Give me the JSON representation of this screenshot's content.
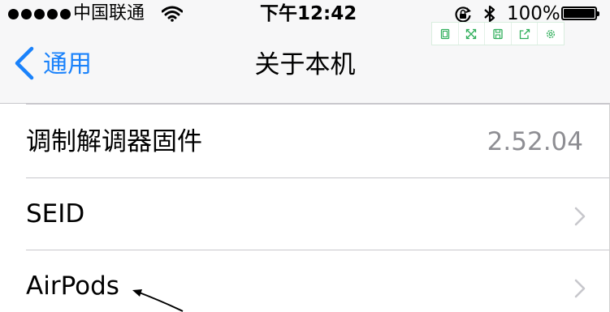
{
  "status_bar": {
    "carrier": "中国联通",
    "time": "下午12:42",
    "battery_percent": "100%",
    "signal_dots": 5,
    "icons": [
      "wifi-icon",
      "rotation-lock-icon",
      "bluetooth-icon",
      "battery-icon"
    ]
  },
  "floating_toolbar": {
    "buttons": [
      "window-icon",
      "expand-icon",
      "save-icon",
      "share-icon",
      "settings-icon"
    ],
    "accent": "#2fae5a"
  },
  "nav": {
    "back_label": "通用",
    "title": "关于本机",
    "accent": "#1a82fb"
  },
  "rows": [
    {
      "label": "调制解调器固件",
      "value": "2.52.04",
      "has_chevron": false
    },
    {
      "label": "SEID",
      "value": "",
      "has_chevron": true
    },
    {
      "label": "AirPods",
      "value": "",
      "has_chevron": true
    }
  ],
  "colors": {
    "bar_background": "#f7f7f8",
    "separator": "#c8c7cc",
    "secondary_text": "#8e8e93"
  }
}
